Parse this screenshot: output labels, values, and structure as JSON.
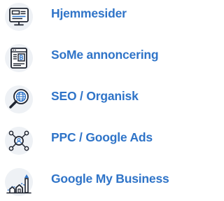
{
  "theme": {
    "accent": "#2f74c8",
    "circle_fill": "#eef1f5",
    "icon_stroke": "#1f2430",
    "text_color": "#2f74c8"
  },
  "services": [
    {
      "label": "Hjemmesider",
      "icon": "website-monitor-icon"
    },
    {
      "label": "SoMe annoncering",
      "icon": "social-media-ad-icon"
    },
    {
      "label": "SEO / Organisk",
      "icon": "seo-magnifier-globe-icon"
    },
    {
      "label": "PPC / Google Ads",
      "icon": "ppc-network-icon"
    },
    {
      "label": "Google My Business",
      "icon": "google-my-business-icon"
    }
  ]
}
